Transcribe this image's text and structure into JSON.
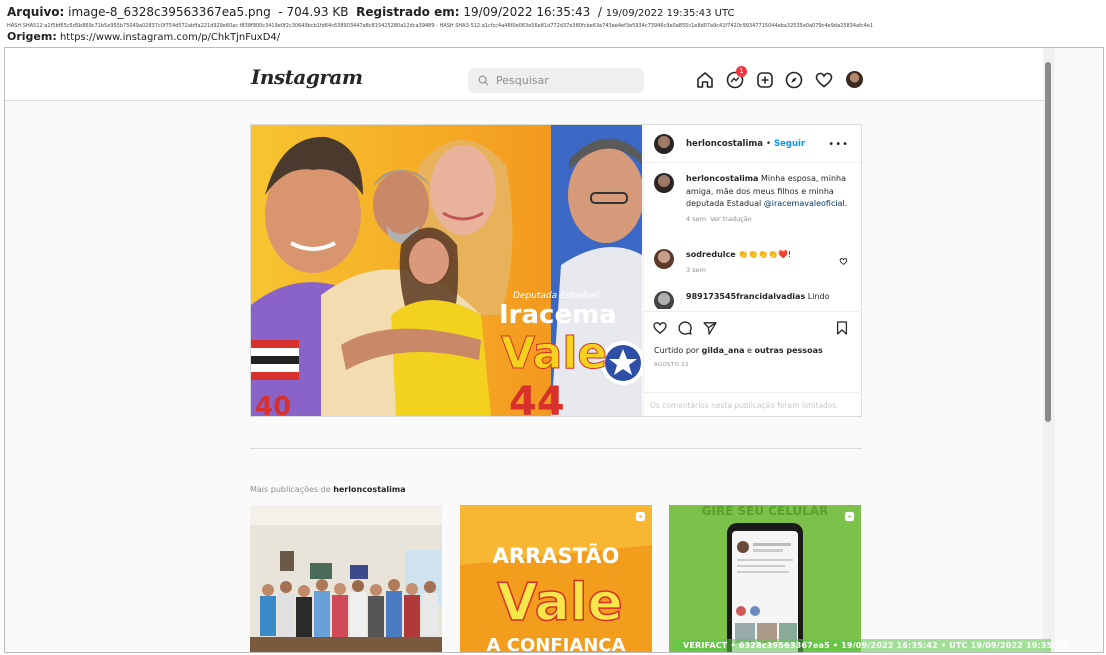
{
  "capture": {
    "file_label": "Arquivo:",
    "file_name": "image-8_6328c39563367ea5.png",
    "file_size": "- 704.93 KB",
    "registered_label": "Registrado em:",
    "registered_local": "19/09/2022 16:35:43",
    "registered_sep": "/",
    "registered_utc": "19/09/2022 19:35:43 UTC",
    "hash_line": "HASH SHA512:a1f5bf65c5d5b869c71b5e955b75049a02837c0f754d572abffa221d929e60ac f838f900c3419e0f2c30649bcb1fd64c638903447e8c815425280a12dca39489   -   HASH SHA3-512:a1cfcc4a46f0e063e56e81d772d37e380fcbe63e743ee4ef3e5934c73946c9e0a855c1e8d07a9c41f7420c99347715044eba32535e0a079c4e9da25834afc4e1",
    "origin_label": "Origem:",
    "origin_url": "https://www.instagram.com/p/ChkTjnFuxD4/"
  },
  "nav": {
    "logo": "Instagram",
    "search_placeholder": "Pesquisar",
    "badge_count": "1"
  },
  "post": {
    "author": "herloncostalima",
    "dot": "•",
    "follow": "Seguir",
    "more": "•••",
    "image_texts": {
      "tag_top": "Deputada Estadual",
      "big1": "Iracema",
      "big2": "Vale",
      "num_left": "40",
      "num_right": "44"
    },
    "caption": {
      "user": "herloncostalima",
      "text": "Minha esposa, minha amiga, mãe dos meus filhos e minha deputada Estadual",
      "mention": "@iracemavaleoficial",
      "after": ".",
      "time": "4 sem",
      "translate": "Ver tradução"
    },
    "comments": [
      {
        "user": "sodredulce",
        "text": "👏👏👏👏❤️!",
        "time": "3 sem"
      },
      {
        "user": "989173545francidalvadias",
        "text": "Lindo"
      }
    ],
    "liked_prefix": "Curtido por",
    "liked_user": "gilda_ana",
    "liked_mid": "e",
    "liked_others": "outras pessoas",
    "date": "AGOSTO 22",
    "comments_limited": "Os comentários nesta publicação foram limitados."
  },
  "more_posts": {
    "prefix": "Mais publicações de",
    "user": "herloncostalima",
    "thumb2_line1": "ARRASTÃO",
    "thumb2_line2": "Vale",
    "thumb2_line3": "A CONFIANÇA",
    "thumb3_banner": "GIRE SEU CELULAR"
  },
  "watermark": "VERIFACT • 6328c39563367ea5 • 19/09/2022 16:35:42 • UTC 19/09/2022 19:35:42"
}
